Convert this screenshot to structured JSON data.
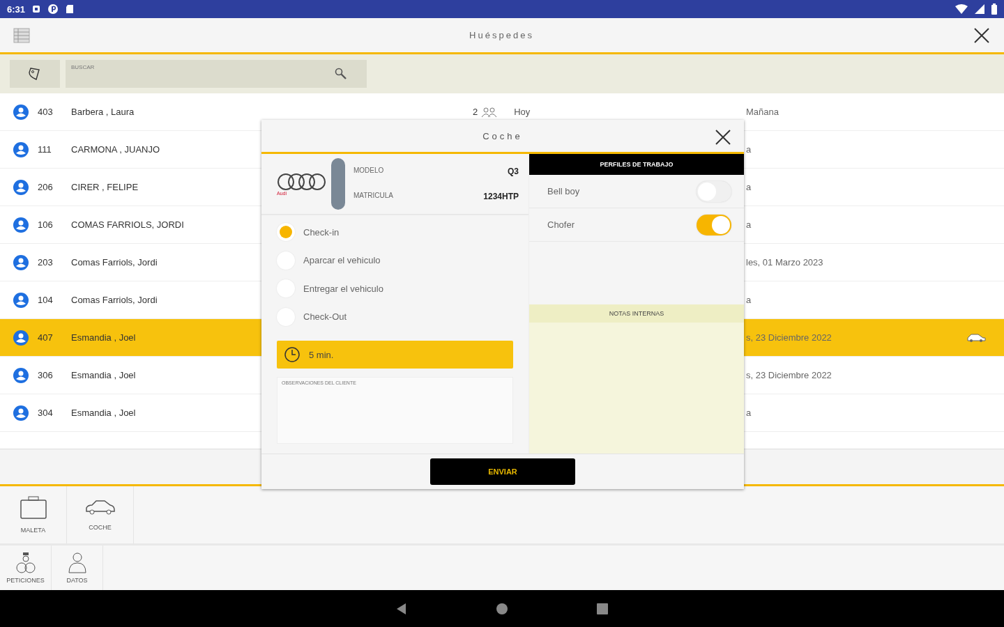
{
  "status_bar": {
    "time": "6:31"
  },
  "header": {
    "title": "Huéspedes"
  },
  "search": {
    "placeholder": "BUSCAR"
  },
  "guests": [
    {
      "room": "403",
      "name": "Barbera , Laura",
      "selected": false,
      "has_car": false,
      "count": "2",
      "arrival": "Hoy",
      "departure": "Mañana"
    },
    {
      "room": "111",
      "name": "CARMONA , JUANJO",
      "selected": false,
      "has_car": false,
      "departure": "a"
    },
    {
      "room": "206",
      "name": "CIRER , FELIPE",
      "selected": false,
      "has_car": false,
      "departure": "a"
    },
    {
      "room": "106",
      "name": "COMAS FARRIOLS, JORDI",
      "selected": false,
      "has_car": false,
      "departure": "a"
    },
    {
      "room": "203",
      "name": "Comas Farriols, Jordi",
      "selected": false,
      "has_car": false,
      "departure": "les, 01 Marzo 2023"
    },
    {
      "room": "104",
      "name": "Comas Farriols, Jordi",
      "selected": false,
      "has_car": false,
      "departure": "a"
    },
    {
      "room": "407",
      "name": "Esmandia , Joel",
      "selected": true,
      "has_car": true,
      "departure": "s, 23 Diciembre 2022"
    },
    {
      "room": "306",
      "name": "Esmandia , Joel",
      "selected": false,
      "has_car": false,
      "departure": "s, 23 Diciembre 2022"
    },
    {
      "room": "304",
      "name": "Esmandia , Joel",
      "selected": false,
      "has_car": false,
      "departure": "a"
    }
  ],
  "dialog": {
    "title": "Coche",
    "car": {
      "brand": "Audi",
      "fields": [
        {
          "label": "MODELO",
          "value": "Q3"
        },
        {
          "label": "MATRICULA",
          "value": "1234HTP"
        }
      ]
    },
    "steps": [
      {
        "label": "Check-in",
        "selected": true
      },
      {
        "label": "Aparcar el vehiculo",
        "selected": false
      },
      {
        "label": "Entregar el vehiculo",
        "selected": false
      },
      {
        "label": "Check-Out",
        "selected": false
      }
    ],
    "time": "5 min.",
    "observations": {
      "placeholder": "OBSERVACIONES DEL CLIENTE"
    },
    "profiles": {
      "title": "PERFILES DE TRABAJO",
      "items": [
        {
          "label": "Bell boy",
          "on": false
        },
        {
          "label": "Chofer",
          "on": true
        }
      ]
    },
    "notes": {
      "title": "NOTAS INTERNAS"
    },
    "send": "ENVIAR"
  },
  "toolbar": [
    {
      "label": "MALETA",
      "kind": "suitcase"
    },
    {
      "label": "COCHE",
      "kind": "car"
    }
  ],
  "toolbar2": [
    {
      "label": "PETICIONES",
      "kind": "bellboy"
    },
    {
      "label": "DATOS",
      "kind": "person"
    }
  ]
}
